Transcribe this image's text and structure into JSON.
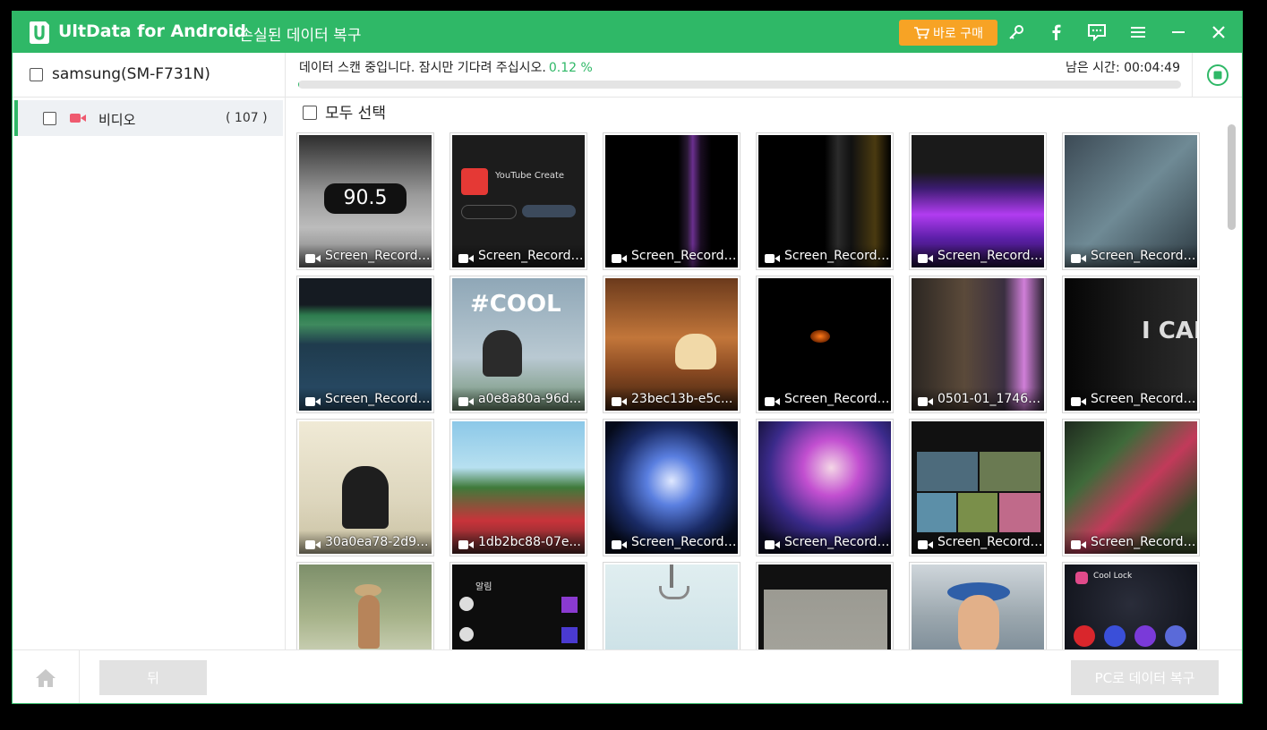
{
  "app": {
    "name": "UltData for Android",
    "subtitle": "- 손실된 데이터 복구",
    "buy_label": "바로 구매"
  },
  "device": {
    "name": "samsung(SM-F731N)"
  },
  "scan": {
    "status_text": "데이터 스캔 중입니다. 잠시만 기다려 주십시오.",
    "percent_text": "0.12 %",
    "progress_fraction": 0.0012,
    "time_label": "남은 시간:",
    "time_value": "00:04:49"
  },
  "sidebar": {
    "items": [
      {
        "label": "비디오",
        "count": "( 107 )"
      }
    ]
  },
  "main": {
    "select_all_label": "모두 선택",
    "tiles": [
      {
        "label": "Screen_Recordi..."
      },
      {
        "label": "Screen_Recordi..."
      },
      {
        "label": "Screen_Recordi..."
      },
      {
        "label": "Screen_Recordi..."
      },
      {
        "label": "Screen_Recordi..."
      },
      {
        "label": "Screen_Recordi..."
      },
      {
        "label": "Screen_Recordi..."
      },
      {
        "label": "a0e8a80a-96d..."
      },
      {
        "label": "23bec13b-e5c..."
      },
      {
        "label": "Screen_Recordi..."
      },
      {
        "label": "0501-01_17460..."
      },
      {
        "label": "Screen_Recordi..."
      },
      {
        "label": "30a0ea78-2d9..."
      },
      {
        "label": "1db2bc88-07e..."
      },
      {
        "label": "Screen_Recordi..."
      },
      {
        "label": "Screen_Recordi..."
      },
      {
        "label": "Screen_Recordi..."
      },
      {
        "label": "Screen_Recordi..."
      },
      {
        "label": ""
      },
      {
        "label": ""
      },
      {
        "label": ""
      },
      {
        "label": ""
      },
      {
        "label": ""
      },
      {
        "label": ""
      }
    ],
    "thumb_text": {
      "radio_freq": "90.5",
      "youtube_create": "YouTube Create",
      "cool": "#COOL",
      "ican": "I CAN",
      "cool_lock": "Cool Lock",
      "notif_title": "알림"
    }
  },
  "footer": {
    "back_label": "뒤",
    "recover_label": "PC로 데이터 복구"
  },
  "colors": {
    "brand_green": "#2fb867",
    "buy_orange": "#f7a325",
    "disabled_button": "#e2e2e2"
  }
}
